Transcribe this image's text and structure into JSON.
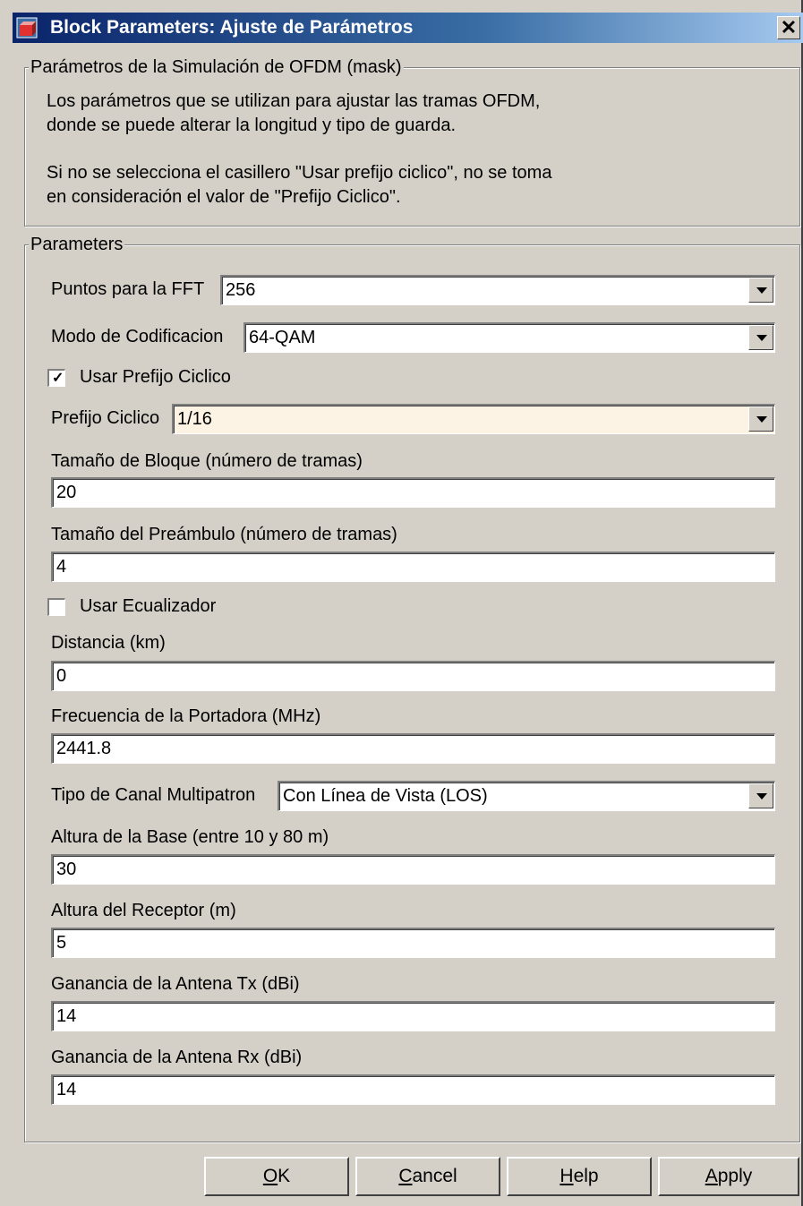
{
  "window": {
    "title": "Block Parameters: Ajuste de Parámetros",
    "close_glyph": "✕"
  },
  "mask_group": {
    "legend": "Parámetros de la Simulación de OFDM (mask)",
    "description_line1": "Los parámetros que se utilizan para ajustar las tramas OFDM,",
    "description_line2": "donde se puede alterar la longitud y tipo de guarda.",
    "description_line3": "Si no se selecciona el casillero \"Usar prefijo ciclico\", no se toma",
    "description_line4": "en consideración el valor de \"Prefijo Ciclico\"."
  },
  "params_group": {
    "legend": "Parameters",
    "fft_points": {
      "label": "Puntos para la FFT",
      "value": "256"
    },
    "coding_mode": {
      "label": "Modo de Codificacion",
      "value": "64-QAM"
    },
    "use_cyclic_prefix": {
      "label": "Usar Prefijo Ciclico",
      "checked": true
    },
    "cyclic_prefix": {
      "label": "Prefijo Ciclico",
      "value": "1/16"
    },
    "block_size": {
      "label": "Tamaño de Bloque (número de tramas)",
      "value": "20"
    },
    "preamble_size": {
      "label": "Tamaño del Preámbulo (número de tramas)",
      "value": "4"
    },
    "use_equalizer": {
      "label": "Usar Ecualizador",
      "checked": false
    },
    "distance": {
      "label": "Distancia (km)",
      "value": "0"
    },
    "carrier_freq": {
      "label": "Frecuencia de la Portadora (MHz)",
      "value": "2441.8"
    },
    "multipath_type": {
      "label": "Tipo de Canal Multipatron",
      "value": "Con Línea de Vista (LOS)"
    },
    "base_height": {
      "label": "Altura de la Base (entre 10 y 80 m)",
      "value": "30"
    },
    "receiver_height": {
      "label": "Altura del Receptor (m)",
      "value": "5"
    },
    "tx_gain": {
      "label": "Ganancia de la Antena Tx (dBi)",
      "value": "14"
    },
    "rx_gain": {
      "label": "Ganancia de la Antena Rx (dBi)",
      "value": "14"
    }
  },
  "buttons": {
    "ok": {
      "mnemonic": "O",
      "rest": "K"
    },
    "cancel": {
      "mnemonic": "C",
      "rest": "ancel"
    },
    "help": {
      "mnemonic": "H",
      "rest": "elp"
    },
    "apply": {
      "mnemonic": "A",
      "rest": "pply"
    }
  },
  "icons": {
    "app": "simulink-block-icon",
    "close": "close-icon",
    "dropdown": "chevron-down-icon",
    "check": "check-icon"
  }
}
